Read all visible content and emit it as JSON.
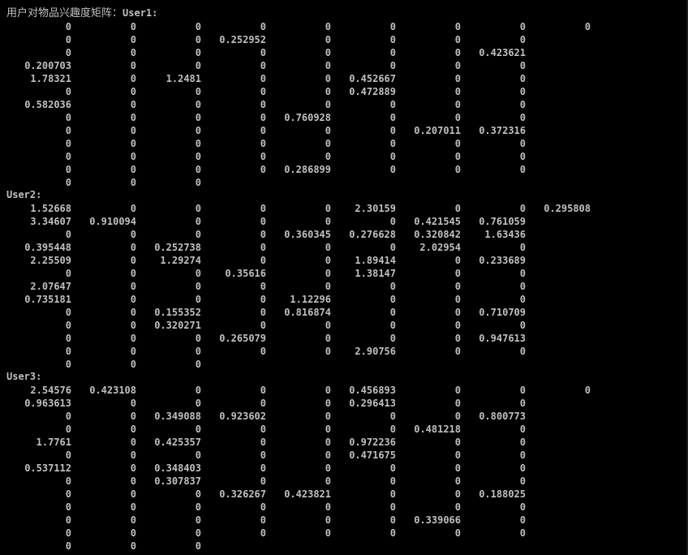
{
  "console": {
    "header_prefix": "用户对物品兴趣度矩阵：",
    "blocks": [
      {
        "label": "User1:",
        "rows": [
          [
            "0",
            "0",
            "0",
            "0",
            "0",
            "0",
            "0",
            "0",
            "0"
          ],
          [
            "0",
            "0",
            "0",
            "0.252952",
            "0",
            "0",
            "0",
            "0"
          ],
          [
            "0",
            "0",
            "0",
            "0",
            "0",
            "0",
            "0",
            "0.423621"
          ],
          [
            "0.200703",
            "0",
            "0",
            "0",
            "0",
            "0",
            "0",
            "0"
          ],
          [
            "1.78321",
            "0",
            "1.2481",
            "0",
            "0",
            "0.452667",
            "0",
            "0"
          ],
          [
            "0",
            "0",
            "0",
            "0",
            "0",
            "0.472889",
            "0",
            "0"
          ],
          [
            "0.582036",
            "0",
            "0",
            "0",
            "0",
            "0",
            "0",
            "0"
          ],
          [
            "0",
            "0",
            "0",
            "0",
            "0.760928",
            "0",
            "0",
            "0"
          ],
          [
            "0",
            "0",
            "0",
            "0",
            "0",
            "0",
            "0.207011",
            "0.372316"
          ],
          [
            "0",
            "0",
            "0",
            "0",
            "0",
            "0",
            "0",
            "0"
          ],
          [
            "0",
            "0",
            "0",
            "0",
            "0",
            "0",
            "0",
            "0"
          ],
          [
            "0",
            "0",
            "0",
            "0",
            "0.286899",
            "0",
            "0",
            "0"
          ],
          [
            "0",
            "0",
            "0"
          ]
        ]
      },
      {
        "label": "User2:",
        "rows": [
          [
            "1.52668",
            "0",
            "0",
            "0",
            "0",
            "2.30159",
            "0",
            "0",
            "0.295808"
          ],
          [
            "3.34607",
            "0.910094",
            "0",
            "0",
            "0",
            "0",
            "0.421545",
            "0.761059"
          ],
          [
            "0",
            "0",
            "0",
            "0",
            "0.360345",
            "0.276628",
            "0.320842",
            "1.63436"
          ],
          [
            "0.395448",
            "0",
            "0.252738",
            "0",
            "0",
            "0",
            "2.02954",
            "0"
          ],
          [
            "2.25509",
            "0",
            "1.29274",
            "0",
            "0",
            "1.89414",
            "0",
            "0.233689"
          ],
          [
            "0",
            "0",
            "0",
            "0.35616",
            "0",
            "1.38147",
            "0",
            "0"
          ],
          [
            "2.07647",
            "0",
            "0",
            "0",
            "0",
            "0",
            "0",
            "0"
          ],
          [
            "0.735181",
            "0",
            "0",
            "0",
            "1.12296",
            "0",
            "0",
            "0"
          ],
          [
            "0",
            "0",
            "0.155352",
            "0",
            "0.816874",
            "0",
            "0",
            "0.710709"
          ],
          [
            "0",
            "0",
            "0.320271",
            "0",
            "0",
            "0",
            "0",
            "0"
          ],
          [
            "0",
            "0",
            "0",
            "0.265079",
            "0",
            "0",
            "0",
            "0.947613"
          ],
          [
            "0",
            "0",
            "0",
            "0",
            "0",
            "2.90756",
            "0",
            "0"
          ],
          [
            "0",
            "0",
            "0"
          ]
        ]
      },
      {
        "label": "User3:",
        "rows": [
          [
            "2.54576",
            "0.423108",
            "0",
            "0",
            "0",
            "0.456893",
            "0",
            "0",
            "0"
          ],
          [
            "0.963613",
            "0",
            "0",
            "0",
            "0",
            "0.296413",
            "0",
            "0"
          ],
          [
            "0",
            "0",
            "0.349088",
            "0.923602",
            "0",
            "0",
            "0",
            "0.800773"
          ],
          [
            "0",
            "0",
            "0",
            "0",
            "0",
            "0",
            "0.481218",
            "0"
          ],
          [
            "1.7761",
            "0",
            "0.425357",
            "0",
            "0",
            "0.972236",
            "0",
            "0"
          ],
          [
            "0",
            "0",
            "0",
            "0",
            "0",
            "0.471675",
            "0",
            "0"
          ],
          [
            "0.537112",
            "0",
            "0.348403",
            "0",
            "0",
            "0",
            "0",
            "0"
          ],
          [
            "0",
            "0",
            "0.307837",
            "0",
            "0",
            "0",
            "0",
            "0"
          ],
          [
            "0",
            "0",
            "0",
            "0.326267",
            "0.423821",
            "0",
            "0",
            "0.188025"
          ],
          [
            "0",
            "0",
            "0",
            "0",
            "0",
            "0",
            "0",
            "0"
          ],
          [
            "0",
            "0",
            "0",
            "0",
            "0",
            "0",
            "0.339066",
            "0"
          ],
          [
            "0",
            "0",
            "0",
            "0",
            "0",
            "0",
            "0",
            "0"
          ],
          [
            "0",
            "0",
            "0"
          ]
        ]
      }
    ]
  }
}
